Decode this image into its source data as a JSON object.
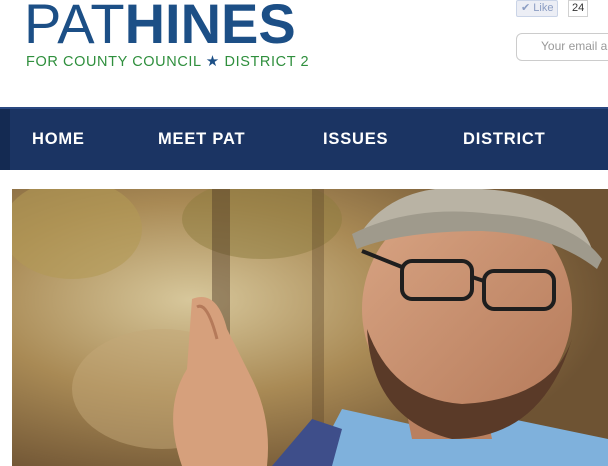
{
  "logo": {
    "name_light": "PAT",
    "name_bold": "HINES",
    "tagline_left": "FOR COUNTY COUNCIL",
    "tagline_right": "DISTRICT 2",
    "star": "★"
  },
  "social": {
    "like_label": "Like",
    "like_count": "24"
  },
  "signup": {
    "email_placeholder": "Your email a"
  },
  "nav": {
    "items": [
      {
        "label": "HOME"
      },
      {
        "label": "MEET PAT"
      },
      {
        "label": "ISSUES"
      },
      {
        "label": "DISTRICT"
      }
    ]
  },
  "hero": {
    "icon": "photo-of-candidate"
  },
  "colors": {
    "brand_blue": "#1c4f86",
    "brand_green": "#2f8f3d",
    "nav_bg": "#1b3463"
  }
}
